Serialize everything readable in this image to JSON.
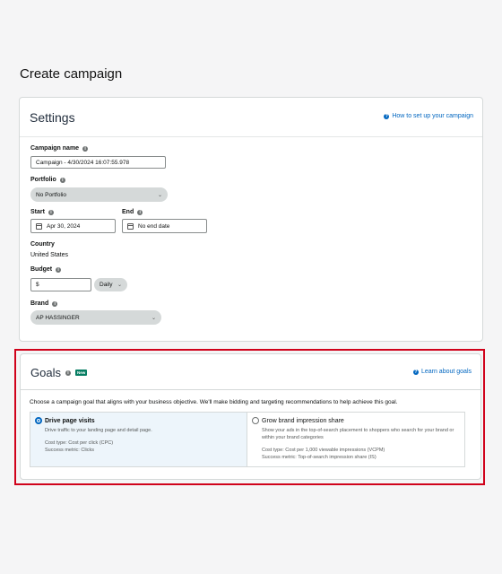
{
  "page": {
    "title": "Create campaign"
  },
  "settings": {
    "title": "Settings",
    "help_link": "How to set up your campaign",
    "campaign_name": {
      "label": "Campaign name",
      "value": "Campaign - 4/30/2024 16:07:55.978"
    },
    "portfolio": {
      "label": "Portfolio",
      "value": "No Portfolio"
    },
    "start": {
      "label": "Start",
      "value": "Apr 30, 2024"
    },
    "end": {
      "label": "End",
      "value": "No end date"
    },
    "country": {
      "label": "Country",
      "value": "United States"
    },
    "budget": {
      "label": "Budget",
      "placeholder": "$",
      "period": "Daily"
    },
    "brand": {
      "label": "Brand",
      "value": "AP HASSINGER"
    }
  },
  "goals": {
    "title": "Goals",
    "badge": "New",
    "help_link": "Learn about goals",
    "description": "Choose a campaign goal that aligns with your business objective. We'll make bidding and targeting recommendations to help achieve this goal.",
    "options": [
      {
        "title": "Drive page visits",
        "subtitle": "Drive traffic to your landing page and detail page.",
        "cost_type": "Cost type: Cost per click (CPC)",
        "metric": "Success metric: Clicks",
        "selected": true
      },
      {
        "title": "Grow brand impression share",
        "subtitle": "Show your ads in the top-of-search placement to shoppers who search for your brand or within your brand categories",
        "cost_type": "Cost type: Cost per 1,000 viewable impressions (VCPM)",
        "metric": "Success metric: Top-of-search impression share (IS)",
        "selected": false
      }
    ]
  },
  "colors": {
    "highlight": "#d0021b",
    "link": "#0066c0",
    "selected_bg": "#edf5fb"
  }
}
